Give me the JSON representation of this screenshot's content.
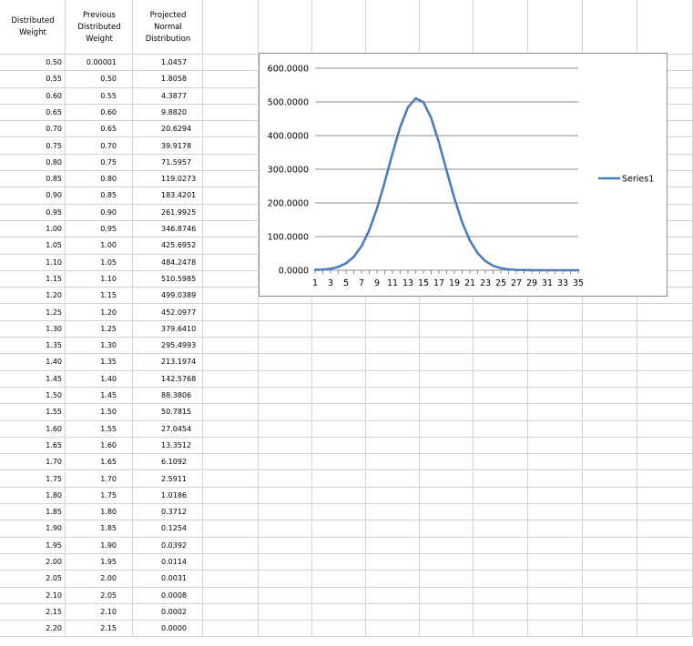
{
  "headers": {
    "col1": "Distributed\nWeight",
    "col2": "Previous\nDistributed\nWeight",
    "col3": "Projected\nNormal\nDistribution"
  },
  "rows": [
    [
      "0.50",
      "0.00001",
      "1.0457"
    ],
    [
      "0.55",
      "0.50",
      "1.8058"
    ],
    [
      "0.60",
      "0.55",
      "4.3877"
    ],
    [
      "0.65",
      "0.60",
      "9.8820"
    ],
    [
      "0.70",
      "0.65",
      "20.6294"
    ],
    [
      "0.75",
      "0.70",
      "39.9178"
    ],
    [
      "0.80",
      "0.75",
      "71.5957"
    ],
    [
      "0.85",
      "0.80",
      "119.0273"
    ],
    [
      "0.90",
      "0.85",
      "183.4201"
    ],
    [
      "0.95",
      "0.90",
      "261.9925"
    ],
    [
      "1.00",
      "0.95",
      "346.8746"
    ],
    [
      "1.05",
      "1.00",
      "425.6952"
    ],
    [
      "1.10",
      "1.05",
      "484.2478"
    ],
    [
      "1.15",
      "1.10",
      "510.5985"
    ],
    [
      "1.20",
      "1.15",
      "499.0389"
    ],
    [
      "1.25",
      "1.20",
      "452.0977"
    ],
    [
      "1.30",
      "1.25",
      "379.6410"
    ],
    [
      "1.35",
      "1.30",
      "295.4993"
    ],
    [
      "1.40",
      "1.35",
      "213.1974"
    ],
    [
      "1.45",
      "1.40",
      "142.5768"
    ],
    [
      "1.50",
      "1.45",
      "88.3806"
    ],
    [
      "1.55",
      "1.50",
      "50.7815"
    ],
    [
      "1.60",
      "1.55",
      "27.0454"
    ],
    [
      "1.65",
      "1.60",
      "13.3512"
    ],
    [
      "1.70",
      "1.65",
      "6.1092"
    ],
    [
      "1.75",
      "1.70",
      "2.5911"
    ],
    [
      "1.80",
      "1.75",
      "1.0186"
    ],
    [
      "1.85",
      "1.80",
      "0.3712"
    ],
    [
      "1.90",
      "1.85",
      "0.1254"
    ],
    [
      "1.95",
      "1.90",
      "0.0392"
    ],
    [
      "2.00",
      "1.95",
      "0.0114"
    ],
    [
      "2.05",
      "2.00",
      "0.0031"
    ],
    [
      "2.10",
      "2.05",
      "0.0008"
    ],
    [
      "2.15",
      "2.10",
      "0.0002"
    ],
    [
      "2.20",
      "2.15",
      "0.0000"
    ]
  ],
  "chart_data": {
    "type": "line",
    "title": "",
    "xlabel": "",
    "ylabel": "",
    "x_tick_labels": [
      "1",
      "3",
      "5",
      "7",
      "9",
      "11",
      "13",
      "15",
      "17",
      "19",
      "21",
      "23",
      "25",
      "27",
      "29",
      "31",
      "33",
      "35"
    ],
    "y_tick_labels": [
      "0.0000",
      "100.0000",
      "200.0000",
      "300.0000",
      "400.0000",
      "500.0000",
      "600.0000"
    ],
    "ylim": [
      0,
      600
    ],
    "xlim": [
      1,
      35
    ],
    "grid": true,
    "legend_position": "right",
    "series": [
      {
        "name": "Series1",
        "color": "#4a7ebb",
        "x": [
          1,
          2,
          3,
          4,
          5,
          6,
          7,
          8,
          9,
          10,
          11,
          12,
          13,
          14,
          15,
          16,
          17,
          18,
          19,
          20,
          21,
          22,
          23,
          24,
          25,
          26,
          27,
          28,
          29,
          30,
          31,
          32,
          33,
          34,
          35
        ],
        "values": [
          1.0457,
          1.8058,
          4.3877,
          9.882,
          20.6294,
          39.9178,
          71.5957,
          119.0273,
          183.4201,
          261.9925,
          346.8746,
          425.6952,
          484.2478,
          510.5985,
          499.0389,
          452.0977,
          379.641,
          295.4993,
          213.1974,
          142.5768,
          88.3806,
          50.7815,
          27.0454,
          13.3512,
          6.1092,
          2.5911,
          1.0186,
          0.3712,
          0.1254,
          0.0392,
          0.0114,
          0.0031,
          0.0008,
          0.0002,
          0.0
        ]
      }
    ]
  }
}
